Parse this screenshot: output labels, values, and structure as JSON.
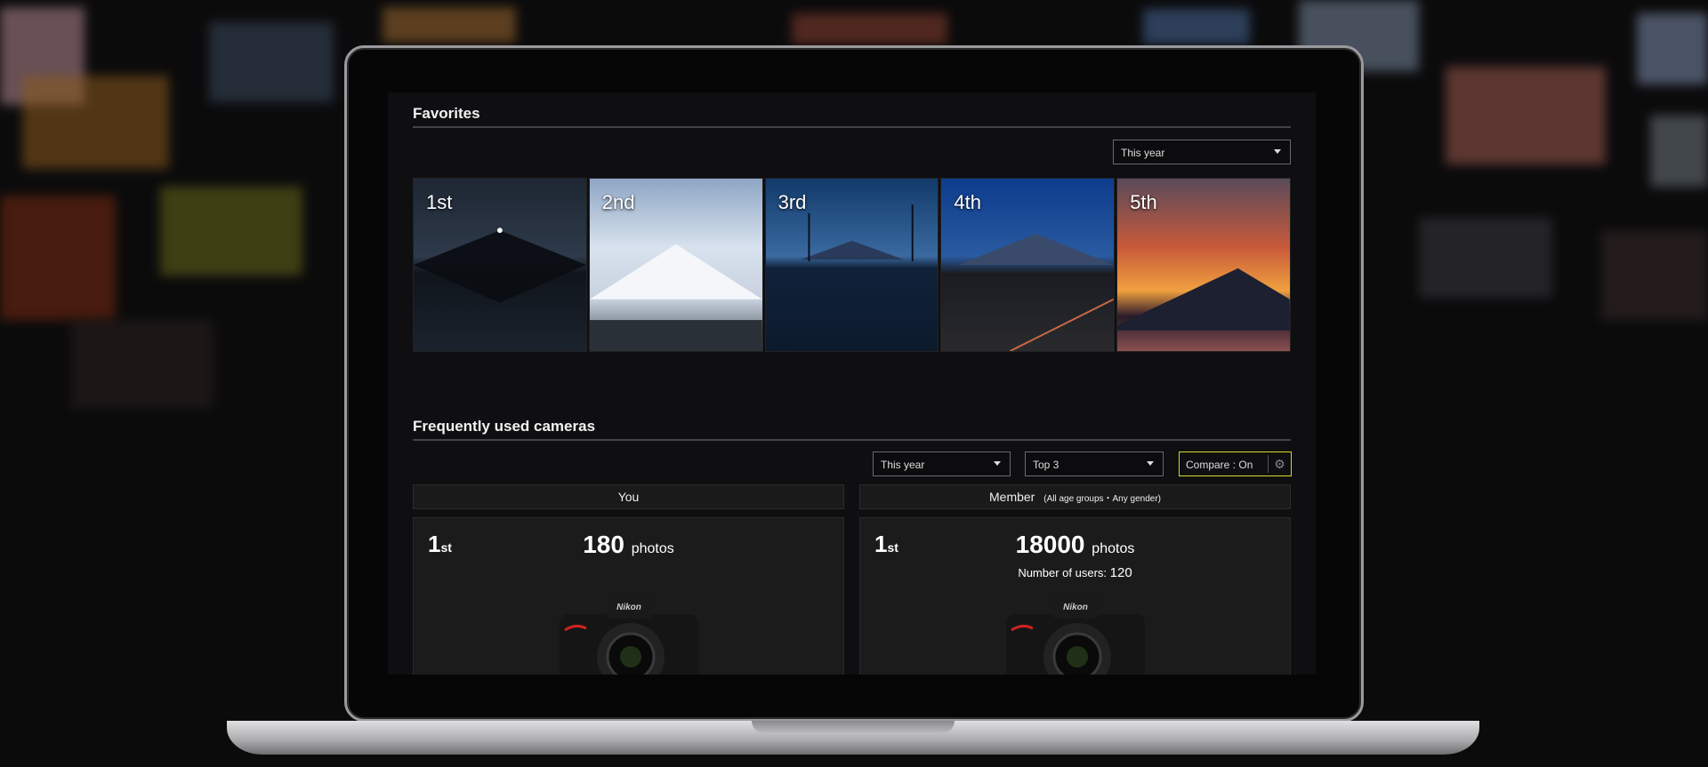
{
  "favorites": {
    "title": "Favorites",
    "period": "This year",
    "ranks": [
      "1st",
      "2nd",
      "3rd",
      "4th",
      "5th"
    ]
  },
  "cameras": {
    "title": "Frequently used cameras",
    "period": "This year",
    "top": "Top 3",
    "compare": "Compare : On",
    "you": {
      "header": "You",
      "rank": "1",
      "rank_suffix": "st",
      "count": "180",
      "unit": "photos"
    },
    "member": {
      "header": "Member",
      "filter": "(All age groups・Any gender)",
      "rank": "1",
      "rank_suffix": "st",
      "count": "18000",
      "unit": "photos",
      "users_label": "Number of users:",
      "users": "120"
    },
    "brand": "Nikon"
  },
  "colors": {
    "accent": "#d8d82a",
    "background": "#0f0e11"
  }
}
